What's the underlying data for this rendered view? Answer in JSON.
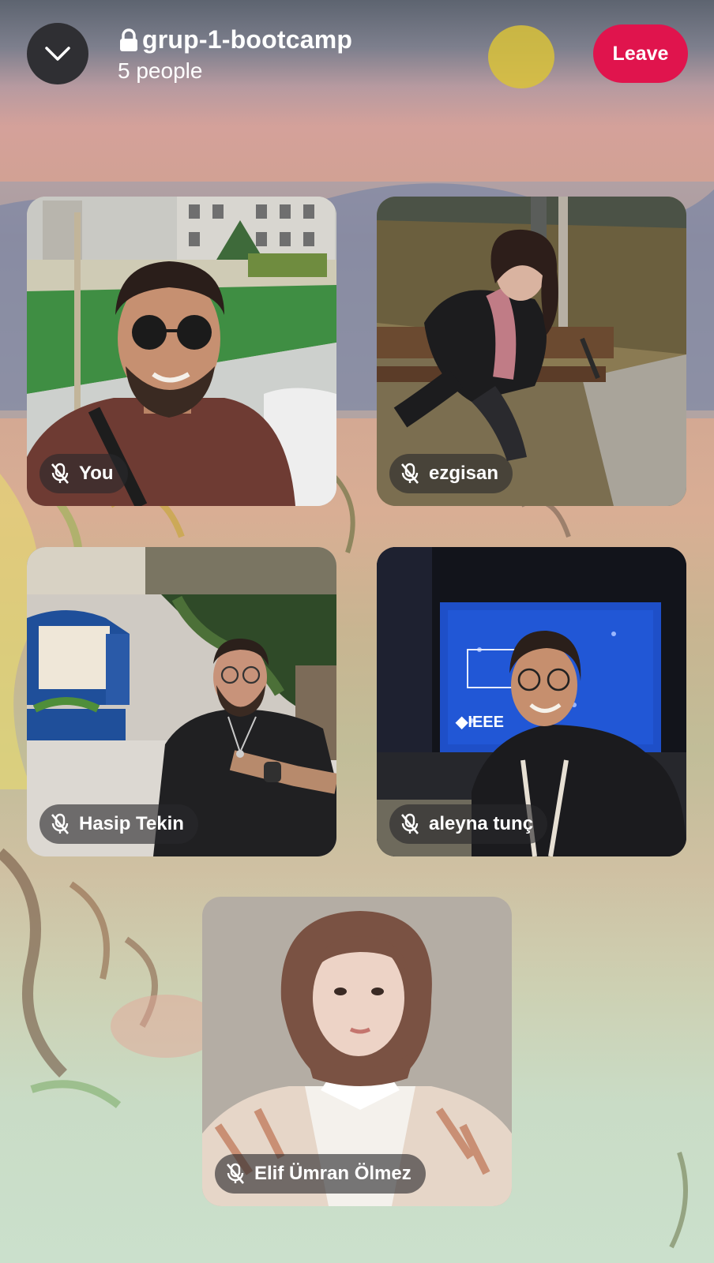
{
  "header": {
    "room_name": "grup-1-bootcamp",
    "people_count": "5 people",
    "leave_label": "Leave",
    "collapse_icon": "chevron-down-icon",
    "lock_icon": "lock-icon",
    "leave_color": "#e0144d"
  },
  "participants": [
    {
      "name": "You",
      "muted": true,
      "mic_icon": "mic-off-icon"
    },
    {
      "name": "ezgisan",
      "muted": true,
      "mic_icon": "mic-off-icon"
    },
    {
      "name": "Hasip Tekin",
      "muted": true,
      "mic_icon": "mic-off-icon"
    },
    {
      "name": "aleyna tunç",
      "muted": true,
      "mic_icon": "mic-off-icon"
    },
    {
      "name": "Elif Ümran Ölmez",
      "muted": true,
      "mic_icon": "mic-off-icon"
    }
  ]
}
